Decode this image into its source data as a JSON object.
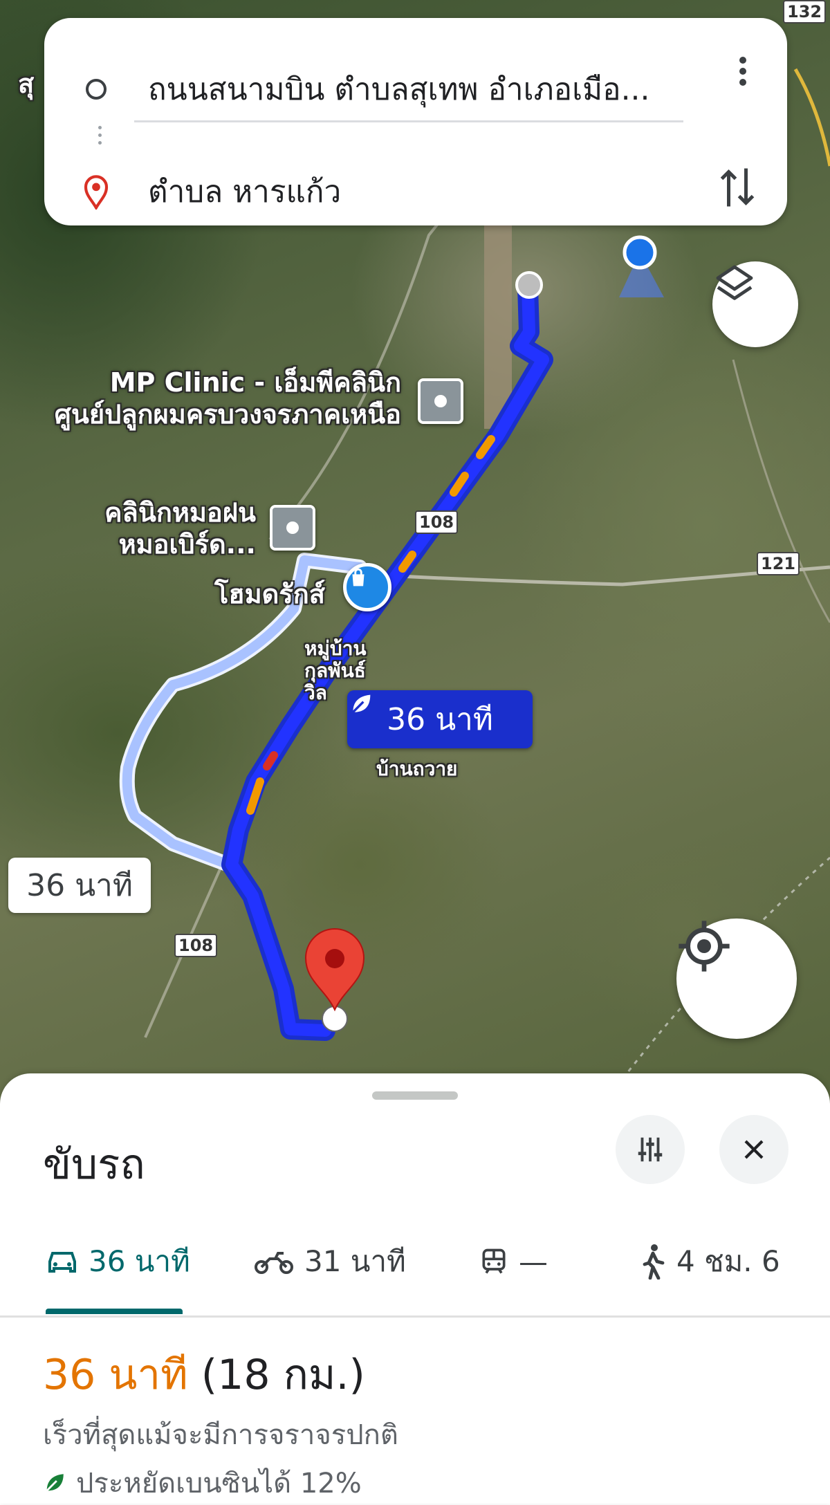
{
  "search": {
    "origin": "ถนนสนามบิน ตำบลสุเทพ อำเภอเมือ...",
    "destination": "ตำบล หารแก้ว"
  },
  "map": {
    "labels": {
      "poi_mp_clinic_line1": "MP Clinic - เอ็มพีคลินิก",
      "poi_mp_clinic_line2": "ศูนย์ปลูกผมครบวงจรภาคเหนือ",
      "poi_clinic2_line1": "คลินิกหมอฝน",
      "poi_clinic2_line2": "หมอเบิร์ด...",
      "poi_homepro": "โฮมดรักส์",
      "village_line1": "หมู่บ้าน",
      "village_line2": "กุลพันธ์",
      "village_line3": "วิล",
      "ban_thawai": "บ้านถวาย",
      "edge_label": "สุ"
    },
    "road_shields": {
      "r132": "132",
      "r108_top": "108",
      "r121": "121",
      "r108_bottom": "108"
    },
    "route_chip_primary": "36 นาที",
    "route_chip_alternate": "36 นาที",
    "colors": {
      "route_primary": "#1a2fcc",
      "route_primary_fill": "#2233ff",
      "route_alt": "#a9c2ff",
      "traffic_orange": "#f29900",
      "traffic_red": "#d93025",
      "pin_red": "#ea4335"
    }
  },
  "icons": {
    "origin": "circle-outline-icon",
    "destination": "location-pin-icon",
    "menu": "more-vert-icon",
    "swap": "swap-vert-icon",
    "layers": "layers-icon",
    "my_location": "my-location-icon",
    "eco": "leaf-icon",
    "options": "tune-icon",
    "close": "close-icon"
  },
  "sheet": {
    "title": "ขับรถ",
    "modes": [
      {
        "icon": "car-icon",
        "label": "36 นาที",
        "active": true
      },
      {
        "icon": "motorcycle-icon",
        "label": "31 นาที",
        "active": false
      },
      {
        "icon": "train-icon",
        "label": "—",
        "active": false
      },
      {
        "icon": "walk-icon",
        "label": "4 ชม. 6",
        "active": false
      }
    ],
    "summary_duration": "36 นาที",
    "summary_distance": "(18 กม.)",
    "note": "เร็วที่สุดแม้จะมีการจราจรปกติ",
    "eco_text": "ประหยัดเบนซินได้ 12%"
  }
}
